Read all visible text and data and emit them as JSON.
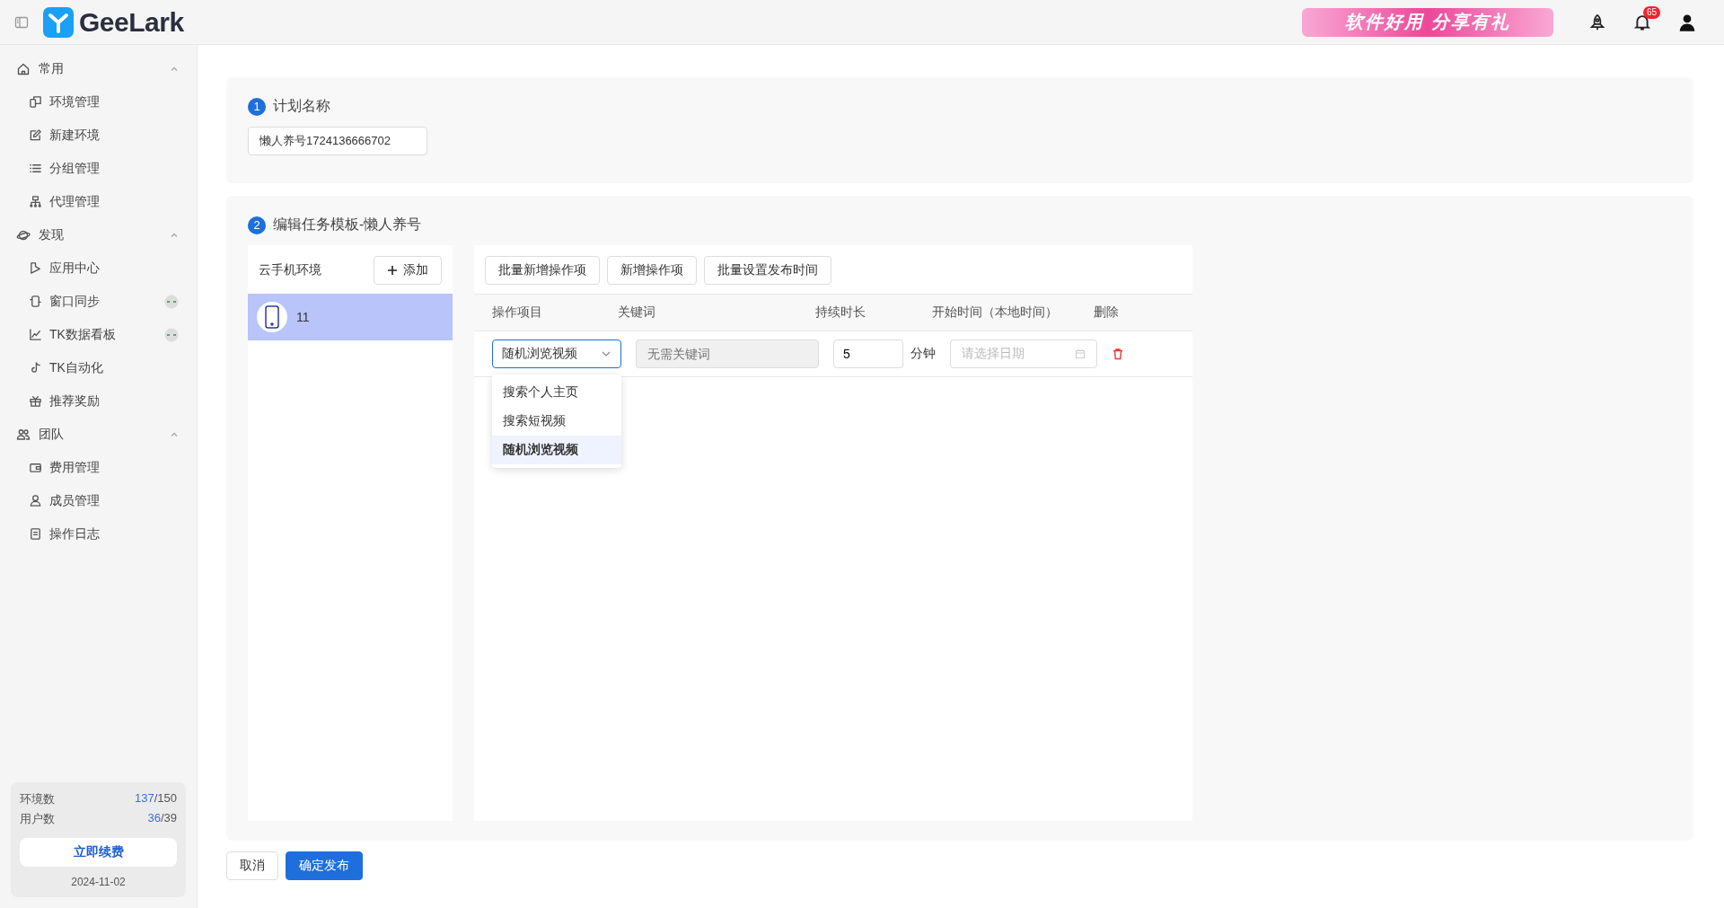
{
  "header": {
    "logo_text": "GeeLark",
    "banner_text": "软件好用 分享有礼",
    "notification_count": "65"
  },
  "sidebar": {
    "groups": [
      {
        "label": "常用",
        "expanded": true,
        "items": [
          {
            "label": "环境管理",
            "indicator": false
          },
          {
            "label": "新建环境",
            "indicator": false
          },
          {
            "label": "分组管理",
            "indicator": false
          },
          {
            "label": "代理管理",
            "indicator": false
          }
        ]
      },
      {
        "label": "发现",
        "expanded": true,
        "items": [
          {
            "label": "应用中心",
            "indicator": false
          },
          {
            "label": "窗口同步",
            "indicator": true
          },
          {
            "label": "TK数据看板",
            "indicator": true
          },
          {
            "label": "TK自动化",
            "indicator": false
          },
          {
            "label": "推荐奖励",
            "indicator": false
          }
        ]
      },
      {
        "label": "团队",
        "expanded": true,
        "items": [
          {
            "label": "费用管理",
            "indicator": false
          },
          {
            "label": "成员管理",
            "indicator": false
          },
          {
            "label": "操作日志",
            "indicator": false
          }
        ]
      }
    ],
    "stats": [
      {
        "label": "环境数",
        "used": "137",
        "total": "/150"
      },
      {
        "label": "用户数",
        "used": "36",
        "total": "/39"
      }
    ],
    "renew_button": "立即续费",
    "date": "2024-11-02"
  },
  "plan_section": {
    "step": "1",
    "title": "计划名称",
    "value": "懒人养号1724136666702"
  },
  "task_section": {
    "step": "2",
    "title": "编辑任务模板-懒人养号",
    "env_panel": {
      "title": "云手机环境",
      "add_button": "添加",
      "items": [
        {
          "name": "11",
          "selected": true
        }
      ]
    },
    "toolbar": [
      "批量新增操作项",
      "新增操作项",
      "批量设置发布时间"
    ],
    "table": {
      "columns": [
        "操作项目",
        "关键词",
        "持续时长",
        "开始时间（本地时间）",
        "删除"
      ],
      "rows": [
        {
          "operation": "随机浏览视频",
          "keyword_placeholder": "无需关键词",
          "keyword_disabled": true,
          "duration": "5",
          "unit": "分钟",
          "start_placeholder": "请选择日期"
        }
      ]
    },
    "dropdown": {
      "open": true,
      "options": [
        {
          "label": "搜索个人主页",
          "selected": false
        },
        {
          "label": "搜索短视频",
          "selected": false
        },
        {
          "label": "随机浏览视频",
          "selected": true
        }
      ]
    }
  },
  "footer": {
    "cancel": "取消",
    "confirm": "确定发布"
  }
}
